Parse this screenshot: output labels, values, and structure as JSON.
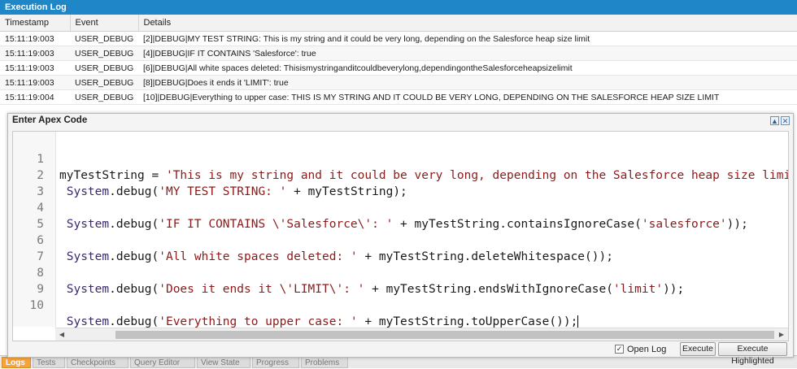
{
  "log": {
    "title": "Execution Log",
    "columns": [
      "Timestamp",
      "Event",
      "Details"
    ],
    "rows": [
      {
        "timestamp": "15:11:19:003",
        "event": "USER_DEBUG",
        "details": "[2]|DEBUG|MY TEST STRING: This is my string and it could be very long, depending on the Salesforce heap size limit"
      },
      {
        "timestamp": "15:11:19:003",
        "event": "USER_DEBUG",
        "details": "[4]|DEBUG|IF IT CONTAINS 'Salesforce': true"
      },
      {
        "timestamp": "15:11:19:003",
        "event": "USER_DEBUG",
        "details": "[6]|DEBUG|All white spaces deleted: Thisismystringanditcouldbeverylong,dependingontheSalesforceheapsizelimit"
      },
      {
        "timestamp": "15:11:19:003",
        "event": "USER_DEBUG",
        "details": "[8]|DEBUG|Does it ends it 'LIMIT': true"
      },
      {
        "timestamp": "15:11:19:004",
        "event": "USER_DEBUG",
        "details": "[10]|DEBUG|Everything to upper case: THIS IS MY STRING AND IT COULD BE VERY LONG, DEPENDING ON THE SALESFORCE HEAP SIZE LIMIT"
      }
    ]
  },
  "tabs": [
    "Logs",
    "Tests",
    "Checkpoints",
    "Query Editor",
    "View State",
    "Progress",
    "Problems"
  ],
  "modal": {
    "title": "Enter Apex Code",
    "line_numbers": [
      "1",
      "2",
      "3",
      "4",
      "5",
      "6",
      "7",
      "8",
      "9",
      "10"
    ],
    "code_lines": [
      "myTestString = 'This is my string and it could be very long, depending on the Salesforce heap size limit';",
      " System.debug('MY TEST STRING: ' + myTestString);",
      "",
      " System.debug('IF IT CONTAINS \\'Salesforce\\': ' + myTestString.containsIgnoreCase('salesforce'));",
      "",
      " System.debug('All white spaces deleted: ' + myTestString.deleteWhitespace());",
      "",
      " System.debug('Does it ends it \\'LIMIT\\': ' + myTestString.endsWithIgnoreCase('limit'));",
      "",
      " System.debug('Everything to upper case: ' + myTestString.toUpperCase());"
    ],
    "open_log_label": "Open Log",
    "open_log_checked": true,
    "execute_label": "Execute",
    "execute_highlighted_label": "Execute Highlighted"
  },
  "colors": {
    "header_blue": "#1f86c7",
    "active_tab": "#f5a33a",
    "code_string": "#8a1b1b",
    "code_keyword": "#3c2a6f"
  },
  "icons": {
    "maximize": "maximize-icon",
    "close": "close-icon",
    "checkbox": "checkmark-icon",
    "scroll_left": "scroll-left-icon",
    "scroll_right": "scroll-right-icon"
  }
}
